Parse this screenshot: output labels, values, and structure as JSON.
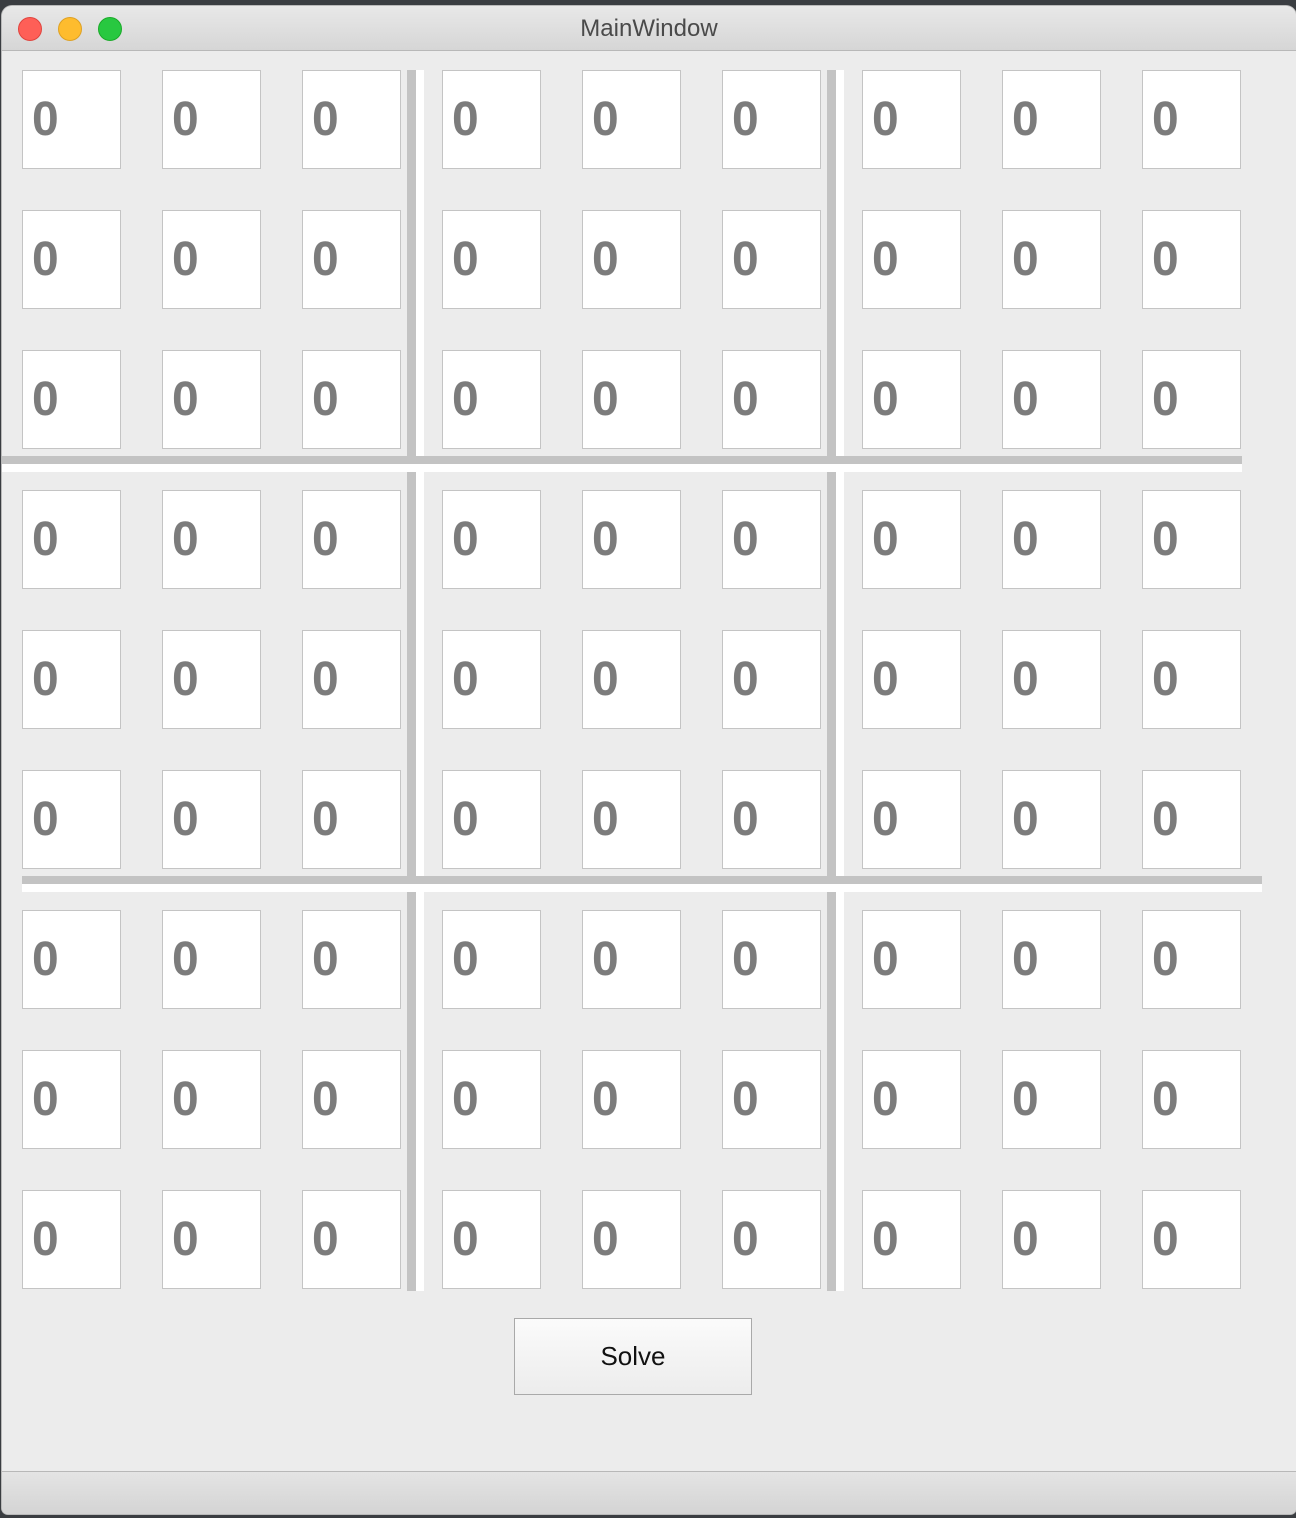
{
  "window": {
    "title": "MainWindow"
  },
  "grid": {
    "rows": [
      [
        "0",
        "0",
        "0",
        "0",
        "0",
        "0",
        "0",
        "0",
        "0"
      ],
      [
        "0",
        "0",
        "0",
        "0",
        "0",
        "0",
        "0",
        "0",
        "0"
      ],
      [
        "0",
        "0",
        "0",
        "0",
        "0",
        "0",
        "0",
        "0",
        "0"
      ],
      [
        "0",
        "0",
        "0",
        "0",
        "0",
        "0",
        "0",
        "0",
        "0"
      ],
      [
        "0",
        "0",
        "0",
        "0",
        "0",
        "0",
        "0",
        "0",
        "0"
      ],
      [
        "0",
        "0",
        "0",
        "0",
        "0",
        "0",
        "0",
        "0",
        "0"
      ],
      [
        "0",
        "0",
        "0",
        "0",
        "0",
        "0",
        "0",
        "0",
        "0"
      ],
      [
        "0",
        "0",
        "0",
        "0",
        "0",
        "0",
        "0",
        "0",
        "0"
      ],
      [
        "0",
        "0",
        "0",
        "0",
        "0",
        "0",
        "0",
        "0",
        "0"
      ]
    ]
  },
  "actions": {
    "solve_label": "Solve"
  },
  "colors": {
    "window_bg": "#ececec",
    "cell_text": "#7c7c7c",
    "separator": "#c3c3c3",
    "close": "#fe5f57",
    "minimize": "#febc2e",
    "maximize": "#28c840"
  }
}
